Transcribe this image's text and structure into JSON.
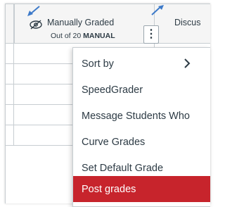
{
  "header": {
    "column": {
      "title": "Manually Graded",
      "subtitle_prefix": "Out of 20",
      "subtitle_bold": "MANUAL",
      "options_label": "⋮"
    },
    "next_column": {
      "title": "Discus"
    }
  },
  "menu": {
    "items": [
      {
        "label": "Sort by",
        "has_submenu": true,
        "active": false
      },
      {
        "label": "SpeedGrader",
        "has_submenu": false,
        "active": false
      },
      {
        "label": "Message Students Who",
        "has_submenu": false,
        "active": false
      },
      {
        "label": "Curve Grades",
        "has_submenu": false,
        "active": false
      },
      {
        "label": "Set Default Grade",
        "has_submenu": false,
        "active": false
      },
      {
        "label": "Post grades",
        "has_submenu": false,
        "active": true
      }
    ]
  },
  "colors": {
    "active_item_bg": "#c7242c",
    "text": "#2d3b45",
    "border": "#c7cdd1",
    "annotation_arrow": "#3d7ac9"
  }
}
